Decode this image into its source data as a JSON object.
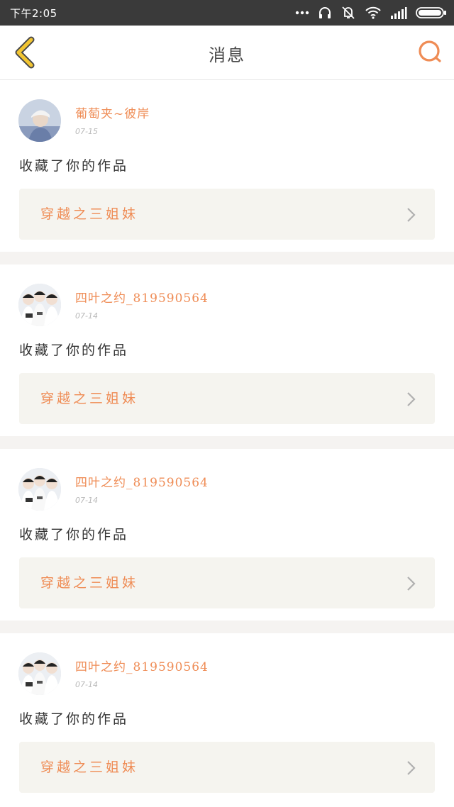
{
  "status_bar": {
    "time": "下午2:05"
  },
  "nav": {
    "title": "消息",
    "back_icon": "chevron-left-icon",
    "search_icon": "search-icon"
  },
  "colors": {
    "accent": "#ef8c55",
    "back_icon": "#f2c532",
    "status_bar_bg": "#3a3a3a",
    "card_box_bg": "#f5f4ef",
    "divider_bg": "#f5f3f1"
  },
  "messages": [
    {
      "username": "葡萄夹~彼岸",
      "date": "07-15",
      "action": "收藏了你的作品",
      "work_title": "穿越之三姐妹",
      "avatar": "avatar-single"
    },
    {
      "username": "四叶之约_819590564",
      "date": "07-14",
      "action": "收藏了你的作品",
      "work_title": "穿越之三姐妹",
      "avatar": "avatar-group"
    },
    {
      "username": "四叶之约_819590564",
      "date": "07-14",
      "action": "收藏了你的作品",
      "work_title": "穿越之三姐妹",
      "avatar": "avatar-group"
    },
    {
      "username": "四叶之约_819590564",
      "date": "07-14",
      "action": "收藏了你的作品",
      "work_title": "穿越之三姐妹",
      "avatar": "avatar-group"
    }
  ]
}
